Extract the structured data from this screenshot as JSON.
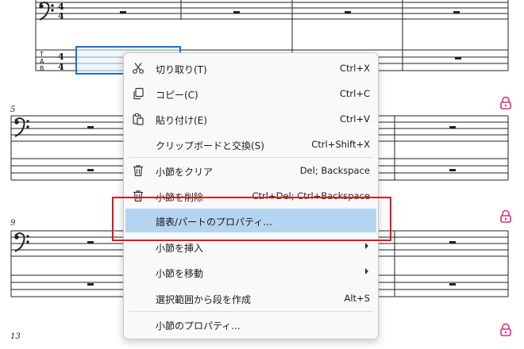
{
  "score": {
    "measure_numbers": [
      "5",
      "9",
      "13"
    ],
    "time_signature": "4/4",
    "tab_label": "TAB",
    "lock_color": "#d62f86",
    "selection_color": "#1e6fd1"
  },
  "context_menu": {
    "items": [
      {
        "label": "切り取り(T)",
        "shortcut": "Ctrl+X",
        "icon": "scissors-icon"
      },
      {
        "label": "コピー(C)",
        "shortcut": "Ctrl+C",
        "icon": "copy-icon"
      },
      {
        "label": "貼り付け(E)",
        "shortcut": "Ctrl+V",
        "icon": "paste-icon"
      },
      {
        "label": "クリップボードと交換(S)",
        "shortcut": "Ctrl+Shift+X"
      },
      {
        "label": "小節をクリア",
        "shortcut": "Del; Backspace",
        "icon": "trash-icon"
      },
      {
        "label": "小節を削除",
        "shortcut": "Ctrl+Del; Ctrl+Backspace",
        "icon": "trash-icon"
      },
      {
        "label": "譜表/パートのプロパティ..."
      },
      {
        "label": "小節を挿入",
        "submenu": true
      },
      {
        "label": "小節を移動",
        "submenu": true
      },
      {
        "label": "選択範囲から段を作成",
        "shortcut": "Alt+S"
      },
      {
        "label": "小節のプロパティ..."
      }
    ],
    "highlighted_label": "譜表/パートのプロパティ...",
    "highlight_color": "#b5d4f2",
    "annotation_color": "#e0161f"
  }
}
